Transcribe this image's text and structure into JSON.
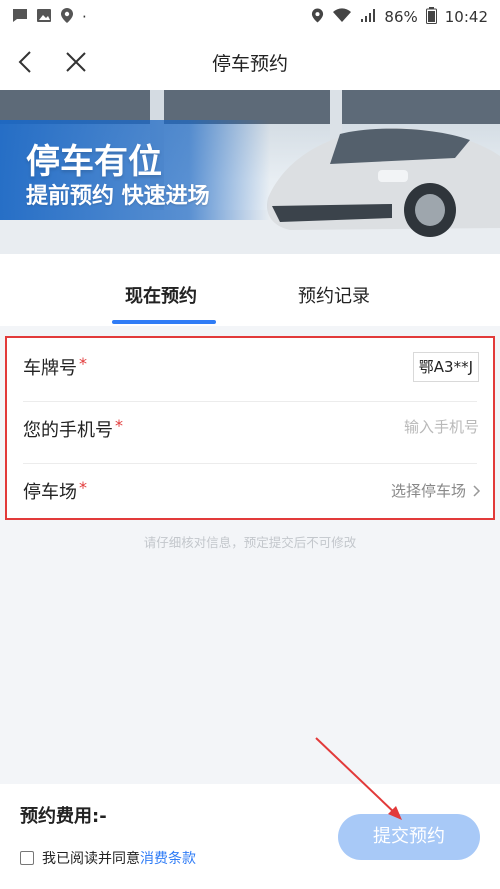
{
  "status_bar": {
    "battery": "86%",
    "time": "10:42",
    "dot": "·"
  },
  "nav": {
    "title": "停车预约"
  },
  "banner": {
    "headline": "停车有位",
    "subline": "提前预约 快速进场"
  },
  "tabs": {
    "current": "现在预约",
    "records": "预约记录"
  },
  "form": {
    "plate": {
      "label": "车牌号",
      "value": "鄂A3**J"
    },
    "phone": {
      "label": "您的手机号",
      "placeholder": "输入手机号"
    },
    "lot": {
      "label": "停车场",
      "value": "选择停车场"
    },
    "required_mark": "*"
  },
  "notice": "请仔细核对信息，预定提交后不可修改",
  "footer": {
    "fee_label": "预约费用:",
    "fee_value": "-",
    "agree_prefix": "我已阅读并同意",
    "terms_link": "消费条款",
    "submit": "提交预约"
  },
  "colors": {
    "accent": "#2f7cf6",
    "submit_bg": "#a8c9f7",
    "required": "#e23a3a",
    "highlight_border": "#e23a3a"
  },
  "icons": [
    "message-icon",
    "image-icon",
    "map-pin-icon",
    "location-icon",
    "wifi-icon",
    "signal-icon",
    "battery-icon",
    "back-icon",
    "close-icon",
    "chevron-right-icon"
  ]
}
